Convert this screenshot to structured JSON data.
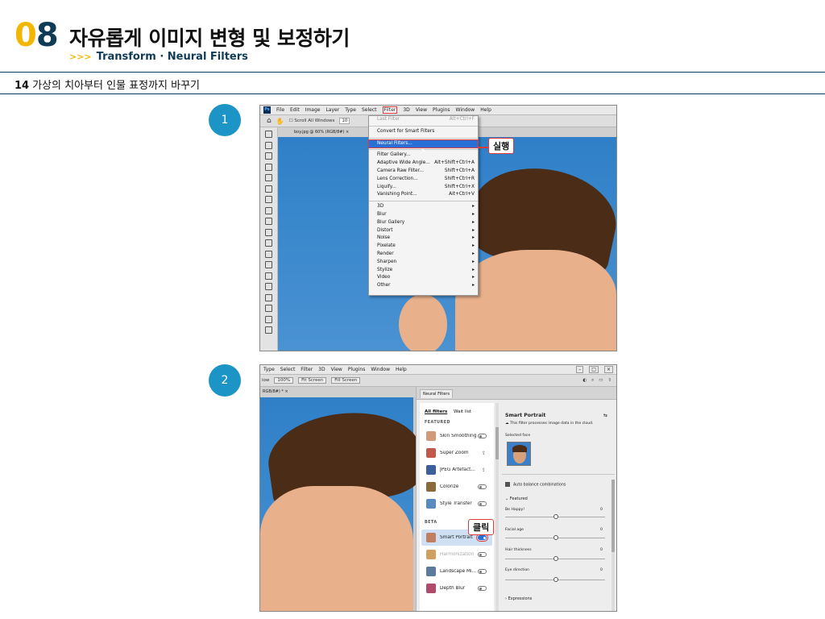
{
  "header": {
    "chapter_0": "0",
    "chapter_8": "8",
    "title": "자유롭게 이미지 변형 및 보정하기",
    "sub_arrows": ">>>",
    "subtitle": "Transform · Neural Filters"
  },
  "section": {
    "num": "14",
    "text": "가상의 치아부터 인물 표정까지 바꾸기"
  },
  "steps": [
    "1",
    "2"
  ],
  "shot1": {
    "menubar": [
      "File",
      "Edit",
      "Image",
      "Layer",
      "Type",
      "Select",
      "Filter",
      "3D",
      "View",
      "Plugins",
      "Window",
      "Help"
    ],
    "ps_icon": "Ps",
    "toolbar": {
      "scroll_all": "Scroll All Windows",
      "zoom": "10"
    },
    "doc_tab": "boy.jpg @ 60% (RGB/8#)",
    "doc_tab_close": "×",
    "filter_menu": {
      "last_filter": {
        "label": "Last Filter",
        "shortcut": "Alt+Ctrl+F"
      },
      "convert": "Convert for Smart Filters",
      "neural": "Neural Filters...",
      "group2": [
        {
          "label": "Filter Gallery...",
          "shortcut": ""
        },
        {
          "label": "Adaptive Wide Angle...",
          "shortcut": "Alt+Shift+Ctrl+A"
        },
        {
          "label": "Camera Raw Filter...",
          "shortcut": "Shift+Ctrl+A"
        },
        {
          "label": "Lens Correction...",
          "shortcut": "Shift+Ctrl+R"
        },
        {
          "label": "Liquify...",
          "shortcut": "Shift+Ctrl+X"
        },
        {
          "label": "Vanishing Point...",
          "shortcut": "Alt+Ctrl+V"
        }
      ],
      "submenus": [
        "3D",
        "Blur",
        "Blur Gallery",
        "Distort",
        "Noise",
        "Pixelate",
        "Render",
        "Sharpen",
        "Stylize",
        "Video",
        "Other"
      ],
      "submenu_arrow": "▸"
    },
    "callout": "실행"
  },
  "shot2": {
    "menubar": [
      "Type",
      "Select",
      "Filter",
      "3D",
      "View",
      "Plugins",
      "Window",
      "Help"
    ],
    "window_controls": [
      "–",
      "□",
      "×"
    ],
    "toolbar": {
      "left": "iow",
      "zoom": "100%",
      "fit": "Fit Screen",
      "fill": "Fill Screen"
    },
    "doc_tab": "RGB/8#) *",
    "doc_tab_close": "×",
    "panel_tab": "Neural Filters",
    "list_tabs": {
      "all": "All filters",
      "wait": "Wait list"
    },
    "featured_label": "FEATURED",
    "featured": [
      {
        "name": "Skin Smoothing",
        "state": "toggle",
        "color": "#d29a7a"
      },
      {
        "name": "Super Zoom",
        "state": "cloud",
        "color": "#c2584a"
      },
      {
        "name": "JPEG Artefact...",
        "state": "cloud",
        "color": "#3a5f9a"
      },
      {
        "name": "Colorize",
        "state": "toggle",
        "color": "#8a6a3a"
      },
      {
        "name": "Style Transfer",
        "state": "toggle",
        "color": "#5a8ac0"
      }
    ],
    "beta_label": "BETA",
    "beta": [
      {
        "name": "Smart Portrait",
        "state": "on",
        "color": "#c08060"
      },
      {
        "name": "Harmonization",
        "state": "toggle",
        "color": "#d0a060"
      },
      {
        "name": "Landscape Mi...",
        "state": "toggle",
        "color": "#5a7aa0"
      },
      {
        "name": "Depth Blur",
        "state": "toggle",
        "color": "#b04a6a"
      }
    ],
    "cloud_glyph": "⇪",
    "callout": "클릭",
    "detail": {
      "title": "Smart Portrait",
      "note": "This filter processes image data in the cloud.",
      "selected_face": "Selected face",
      "auto_balance": "Auto balance combinations",
      "featured": "Featured",
      "sliders": [
        {
          "label": "Be Happy!",
          "value": "0"
        },
        {
          "label": "Facial age",
          "value": "0"
        },
        {
          "label": "Hair thickness",
          "value": "0"
        },
        {
          "label": "Eye direction",
          "value": "0"
        }
      ],
      "expressions": "Expressions"
    }
  }
}
